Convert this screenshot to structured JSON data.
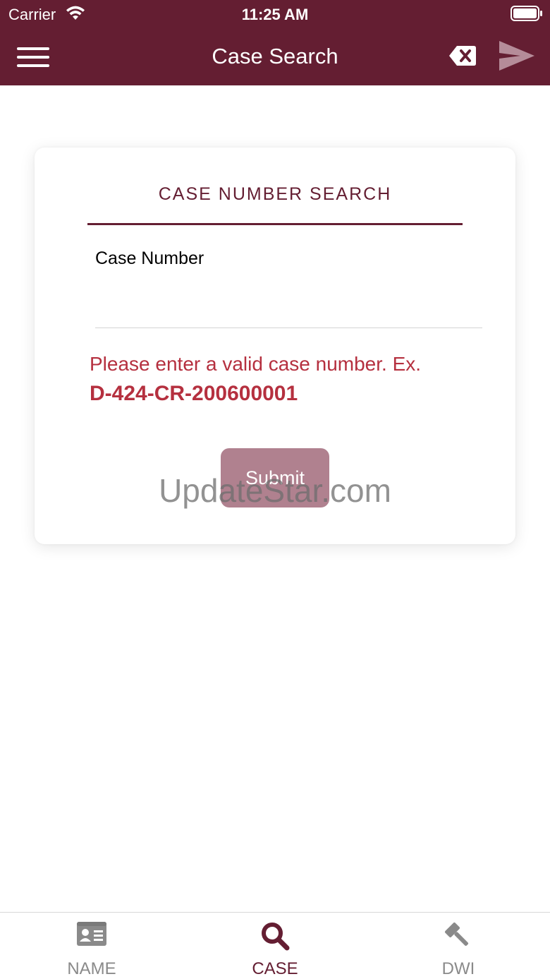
{
  "status_bar": {
    "carrier": "Carrier",
    "time": "11:25 AM"
  },
  "header": {
    "title": "Case Search",
    "menu_icon": "hamburger-menu-icon",
    "clear_icon": "backspace-clear-icon",
    "send_icon": "send-arrow-icon"
  },
  "card": {
    "title": "CASE NUMBER SEARCH",
    "field_label": "Case Number",
    "field_value": "",
    "error_message": "Please enter a valid case number. Ex.",
    "error_example": "D-424-CR-200600001",
    "submit_label": "Submit"
  },
  "watermark": "UpdateStar.com",
  "tabs": [
    {
      "label": "NAME",
      "icon": "id-card-icon",
      "active": false
    },
    {
      "label": "CASE",
      "icon": "search-icon",
      "active": true
    },
    {
      "label": "DWI",
      "icon": "gavel-icon",
      "active": false
    }
  ],
  "colors": {
    "primary": "#641e32",
    "error": "#b5303f",
    "submit_disabled": "#b0818f",
    "inactive_tab": "#8a8a8a"
  }
}
